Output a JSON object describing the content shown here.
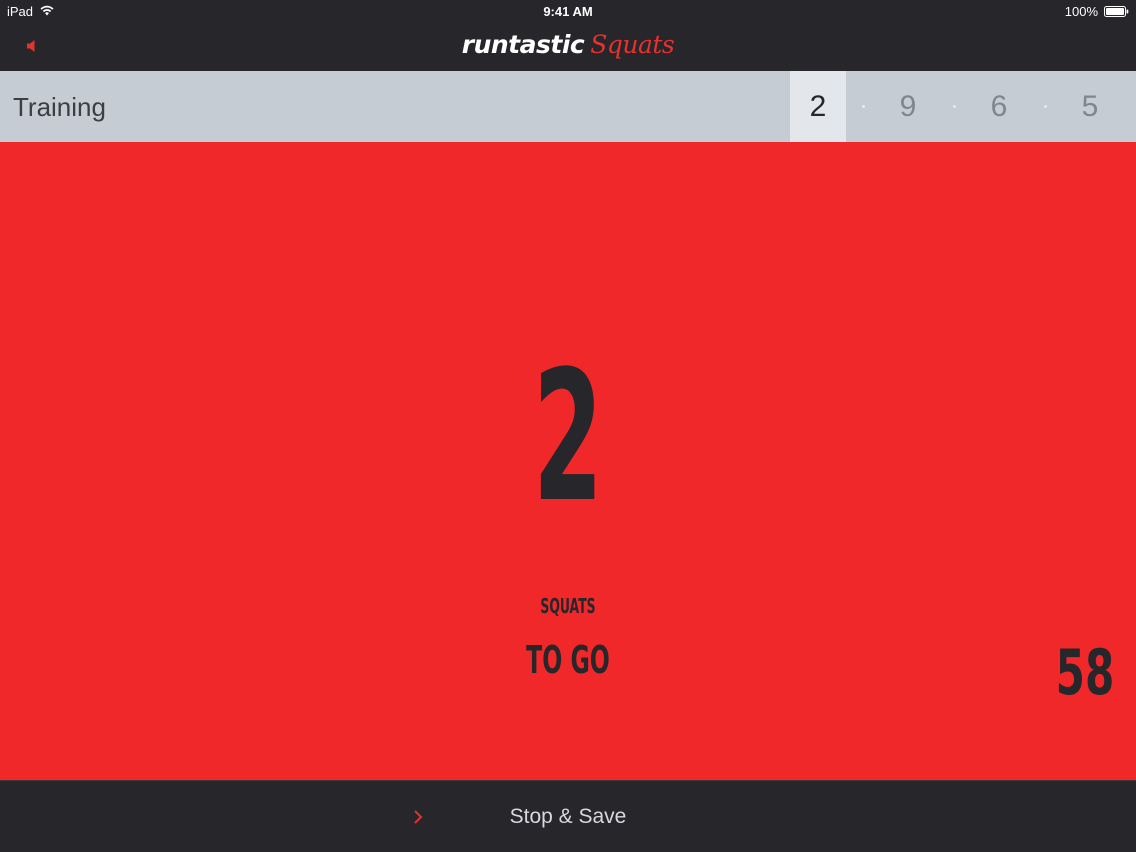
{
  "status_bar": {
    "carrier": "iPad",
    "time": "9:41 AM",
    "battery": "100%"
  },
  "nav": {
    "brand_main": "runtastic",
    "brand_sub": "Squats",
    "sound_icon": "speaker-icon",
    "accent_color": "#e4322f"
  },
  "training": {
    "label": "Training",
    "sets": [
      "2",
      "9",
      "6",
      "5"
    ],
    "active_set_index": 0
  },
  "main": {
    "count": "2",
    "unit": "SQUATS",
    "to_go": "TO GO",
    "timer": "58",
    "background_color": "#f0282a"
  },
  "bottom": {
    "stop_save_label": "Stop & Save",
    "chevron_icon": "chevron-right-icon"
  }
}
